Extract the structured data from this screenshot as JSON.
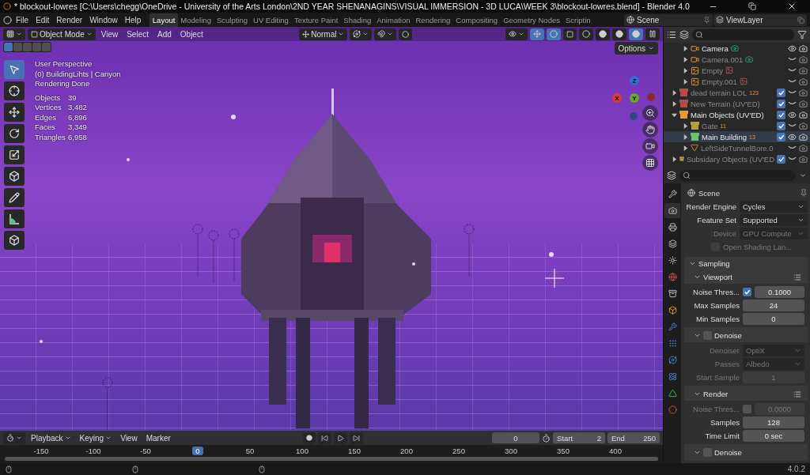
{
  "window": {
    "title": "* blockout-lowres [C:\\Users\\chegg\\OneDrive - University of the Arts London\\2ND YEAR SHENANAGINS\\VISUAL IMMERSION - 3D LUCA\\WEEK 3\\blockout-lowres.blend] - Blender 4.0"
  },
  "menu": [
    "File",
    "Edit",
    "Render",
    "Window",
    "Help"
  ],
  "workspaces": [
    {
      "label": "Layout",
      "selected": true
    },
    {
      "label": "Modeling",
      "selected": false
    },
    {
      "label": "Sculpting",
      "selected": false
    },
    {
      "label": "UV Editing",
      "selected": false
    },
    {
      "label": "Texture Paint",
      "selected": false
    },
    {
      "label": "Shading",
      "selected": false
    },
    {
      "label": "Animation",
      "selected": false
    },
    {
      "label": "Rendering",
      "selected": false
    },
    {
      "label": "Compositing",
      "selected": false
    },
    {
      "label": "Geometry Nodes",
      "selected": false
    },
    {
      "label": "Scriptin",
      "selected": false
    }
  ],
  "scene": "Scene",
  "view_layer": "ViewLayer",
  "viewport": {
    "mode": "Object Mode",
    "menus": [
      "View",
      "Select",
      "Add",
      "Object"
    ],
    "orientation": "Normal",
    "options": "Options",
    "select_modes": [
      {
        "selected": true
      },
      {
        "selected": false
      },
      {
        "selected": false
      },
      {
        "selected": false
      },
      {
        "selected": false
      }
    ],
    "shading_modes": [
      {
        "selected": false
      },
      {
        "selected": false
      },
      {
        "selected": false
      },
      {
        "selected": true
      }
    ],
    "tools": [
      {
        "selected": true
      },
      {
        "selected": false
      },
      {
        "selected": false
      },
      {
        "selected": false
      },
      {
        "selected": false
      },
      {
        "selected": false
      },
      {
        "selected": false
      },
      {
        "selected": false
      },
      {
        "selected": false
      }
    ],
    "info": [
      "User Perspective",
      "(0) BuildingLihts | Canyon",
      "Rendering Done"
    ],
    "stats": [
      {
        "label": "Objects",
        "value": "39"
      },
      {
        "label": "Vertices",
        "value": "3,482"
      },
      {
        "label": "Edges",
        "value": "6,896"
      },
      {
        "label": "Faces",
        "value": "3,349"
      },
      {
        "label": "Triangles",
        "value": "6,958"
      }
    ],
    "axes": [
      {
        "label": "Z",
        "color": "#2f6fd6"
      },
      {
        "label": "X",
        "color": "#d63a3a"
      },
      {
        "label": "Y",
        "color": "#6aa82c"
      }
    ]
  },
  "outliner": {
    "continued_children": [
      {
        "name": "Camera",
        "kind": "camera",
        "visible": true,
        "selected": false
      },
      {
        "name": "Camera.001",
        "kind": "camera",
        "visible": false,
        "selected": false
      },
      {
        "name": "Empty",
        "kind": "empty",
        "visible": false,
        "selected": false
      },
      {
        "name": "Empty.001",
        "kind": "empty",
        "visible": false,
        "selected": false
      }
    ],
    "items": [
      {
        "name": "dead terrain LOL",
        "kind": "collection",
        "color": "#b54a4a",
        "count": "123",
        "checked": true,
        "visible": false,
        "expanded": false,
        "selected": false
      },
      {
        "name": "New Terrain (UV'ED)",
        "kind": "collection",
        "color": "#b54a4a",
        "checked": true,
        "visible": false,
        "expanded": false,
        "selected": false
      },
      {
        "name": "Main Objects (UV'ED)",
        "kind": "collection",
        "color": "#e59a3c",
        "checked": true,
        "visible": true,
        "expanded": true,
        "selected": false,
        "children": [
          {
            "name": "Gate",
            "kind": "collection",
            "color": "#b0a040",
            "count": "11",
            "checked": true,
            "visible": false,
            "expanded": false,
            "selected": false
          },
          {
            "name": "Main Building",
            "kind": "collection",
            "color": "#6ac26a",
            "count": "13",
            "checked": true,
            "visible": true,
            "expanded": false,
            "selected": true
          },
          {
            "name": "LeftSideTunnelBore.0",
            "kind": "mesh",
            "visible": false,
            "expanded": false,
            "selected": false
          }
        ]
      },
      {
        "name": "Subsidary Objects (UV'ED",
        "kind": "collection",
        "color": "#b0a040",
        "checked": true,
        "visible": false,
        "expanded": false,
        "selected": false
      }
    ]
  },
  "properties": {
    "header": "Scene",
    "tabs": [
      {
        "selected": false
      },
      {
        "selected": true
      },
      {
        "selected": false
      },
      {
        "selected": false
      },
      {
        "selected": false
      },
      {
        "selected": false
      },
      {
        "selected": false
      },
      {
        "selected": false
      },
      {
        "selected": false
      },
      {
        "selected": false
      },
      {
        "selected": false
      },
      {
        "selected": false
      },
      {
        "selected": false
      },
      {
        "selected": false
      }
    ],
    "rows": [
      {
        "kind": "dropdown",
        "label": "Render Engine",
        "value": "Cycles",
        "disabled": false
      },
      {
        "kind": "dropdown",
        "label": "Feature Set",
        "value": "Supported",
        "disabled": false
      },
      {
        "kind": "dropdown",
        "label": "Device",
        "value": "GPU Compute",
        "disabled": true
      },
      {
        "kind": "checkbox",
        "label": "Open Shading Lan...",
        "checked": false,
        "disabled": true
      }
    ],
    "panels": [
      {
        "title": "Sampling",
        "expanded": true,
        "children": [
          {
            "title": "Viewport",
            "expanded": true,
            "rows": [
              {
                "kind": "check_number",
                "label": "Noise Thres...",
                "checked": true,
                "value": "0.1000",
                "disabled": false
              },
              {
                "kind": "number",
                "label": "Max Samples",
                "value": "24",
                "disabled": false
              },
              {
                "kind": "number",
                "label": "Min Samples",
                "value": "0",
                "disabled": false
              }
            ]
          },
          {
            "title": "Denoise",
            "expanded": true,
            "checked": false,
            "rows": [
              {
                "kind": "dropdown",
                "label": "Denoiser",
                "value": "OptiX",
                "disabled": true
              },
              {
                "kind": "dropdown",
                "label": "Passes",
                "value": "Albedo",
                "disabled": true
              },
              {
                "kind": "number",
                "label": "Start Sample",
                "value": "1",
                "disabled": true
              }
            ]
          },
          {
            "title": "Render",
            "expanded": true,
            "rows": [
              {
                "kind": "check_number",
                "label": "Noise Thres...",
                "checked": false,
                "value": "0.0000",
                "disabled": true
              },
              {
                "kind": "number",
                "label": "Samples",
                "value": "128",
                "disabled": false
              },
              {
                "kind": "number",
                "label": "Time Limit",
                "value": "0 sec",
                "disabled": false
              }
            ]
          },
          {
            "title": "Denoise",
            "expanded": true,
            "checked": false
          }
        ]
      }
    ]
  },
  "timeline": {
    "menus": [
      {
        "label": "Playback",
        "dropdown": true
      },
      {
        "label": "Keying",
        "dropdown": true
      },
      {
        "label": "View",
        "dropdown": false
      },
      {
        "label": "Marker",
        "dropdown": false
      }
    ],
    "current_frame": "0",
    "start_label": "Start",
    "start": "2",
    "end_label": "End",
    "end": "250",
    "ticks_before": [
      "-150",
      "-100",
      "-50"
    ],
    "playhead": "0",
    "ticks_after": [
      "50",
      "100",
      "150",
      "200",
      "250",
      "300",
      "350",
      "400"
    ]
  },
  "status": {
    "version": "4.0.2"
  }
}
